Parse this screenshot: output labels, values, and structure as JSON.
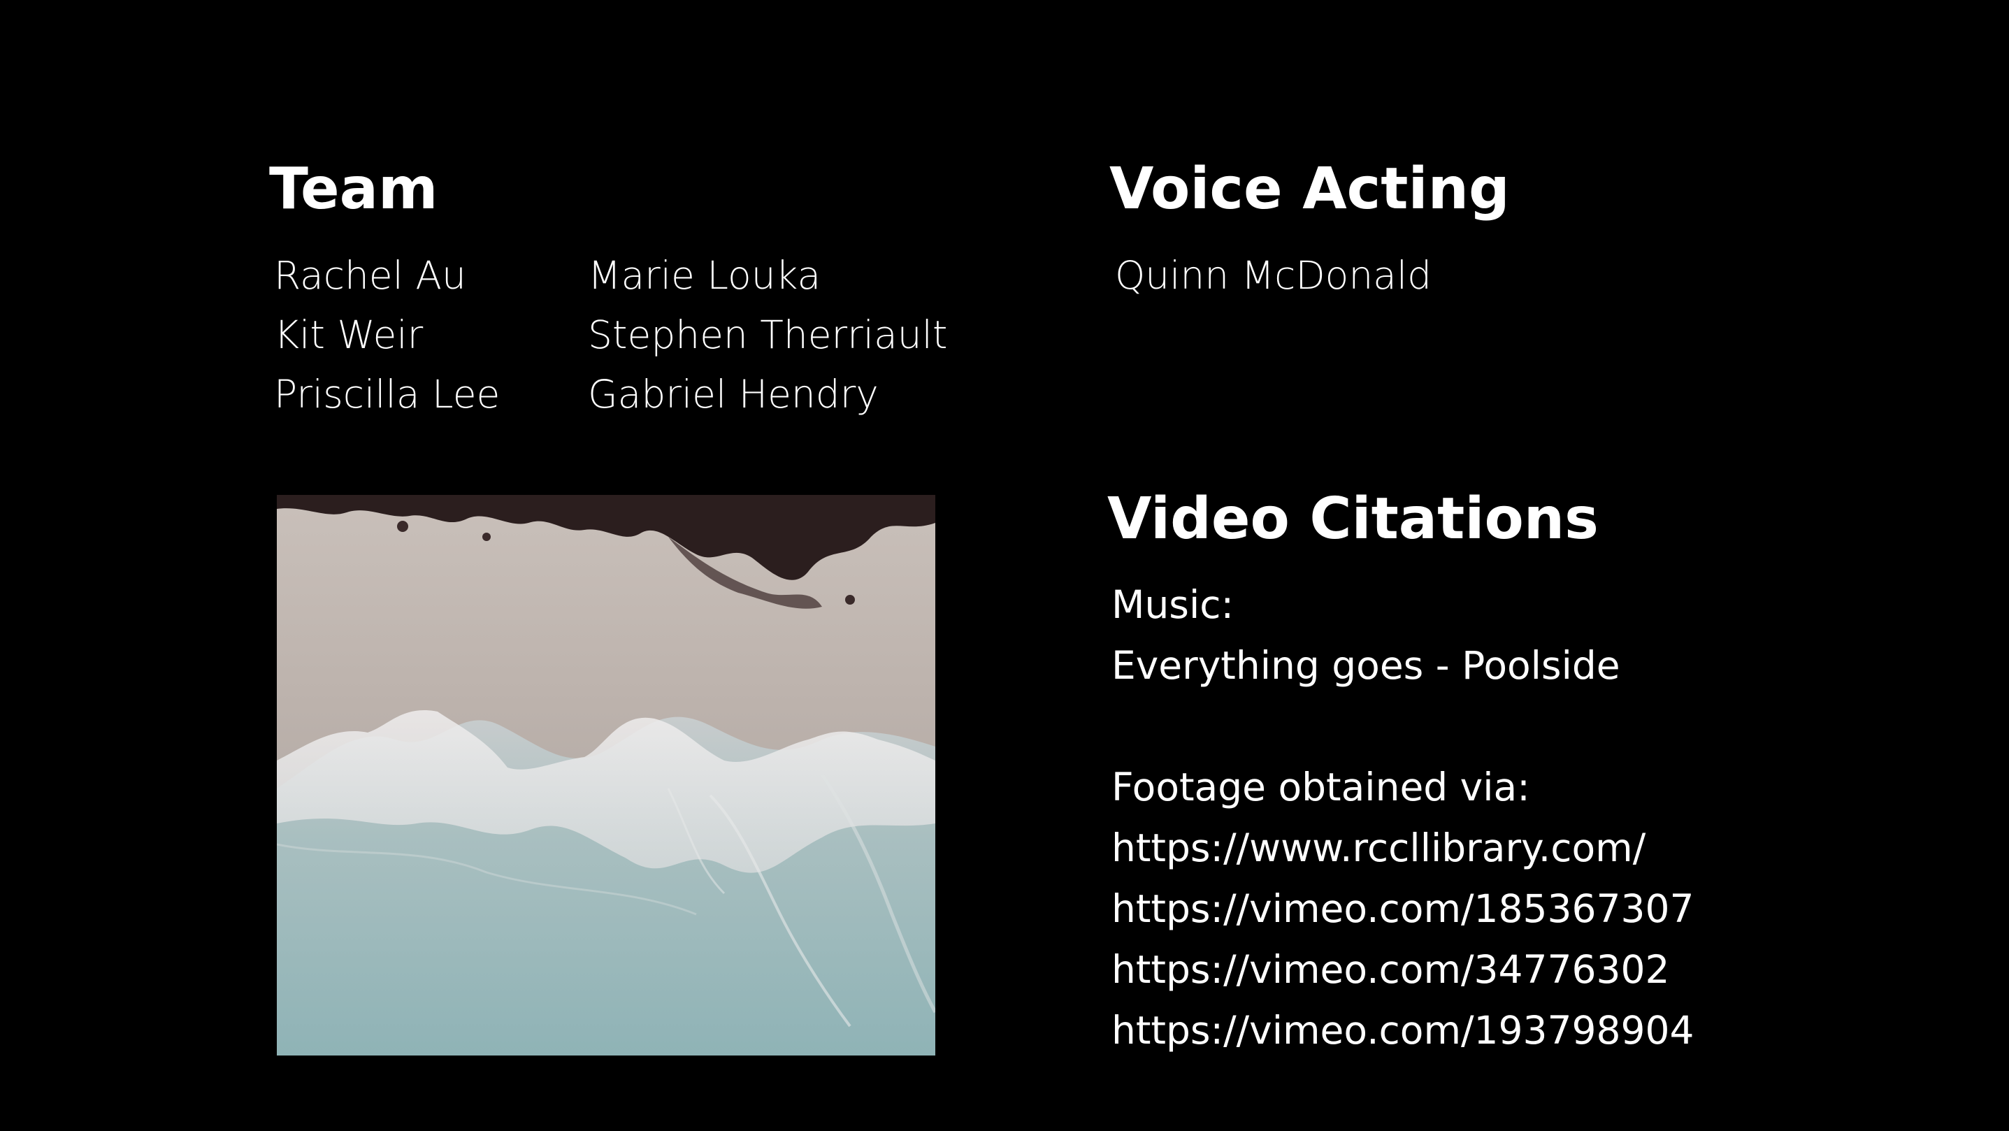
{
  "team": {
    "heading": "Team",
    "column_1": [
      "Rachel Au",
      "Kit Weir",
      "Priscilla Lee"
    ],
    "column_2": [
      "Marie Louka",
      "Stephen Therriault",
      "Gabriel Hendry"
    ]
  },
  "voice_acting": {
    "heading": "Voice Acting",
    "names": [
      "Quinn McDonald"
    ]
  },
  "video_citations": {
    "heading": "Video Citations",
    "music_label": "Music:",
    "music_track": "Everything goes - Poolside",
    "footage_label": "Footage obtained via:",
    "links": [
      "https://www.rccllibrary.com/",
      "https://vimeo.com/185367307",
      "https://vimeo.com/34776302",
      "https://vimeo.com/193798904"
    ]
  },
  "colors": {
    "background": "#000000",
    "text": "#ffffff"
  }
}
